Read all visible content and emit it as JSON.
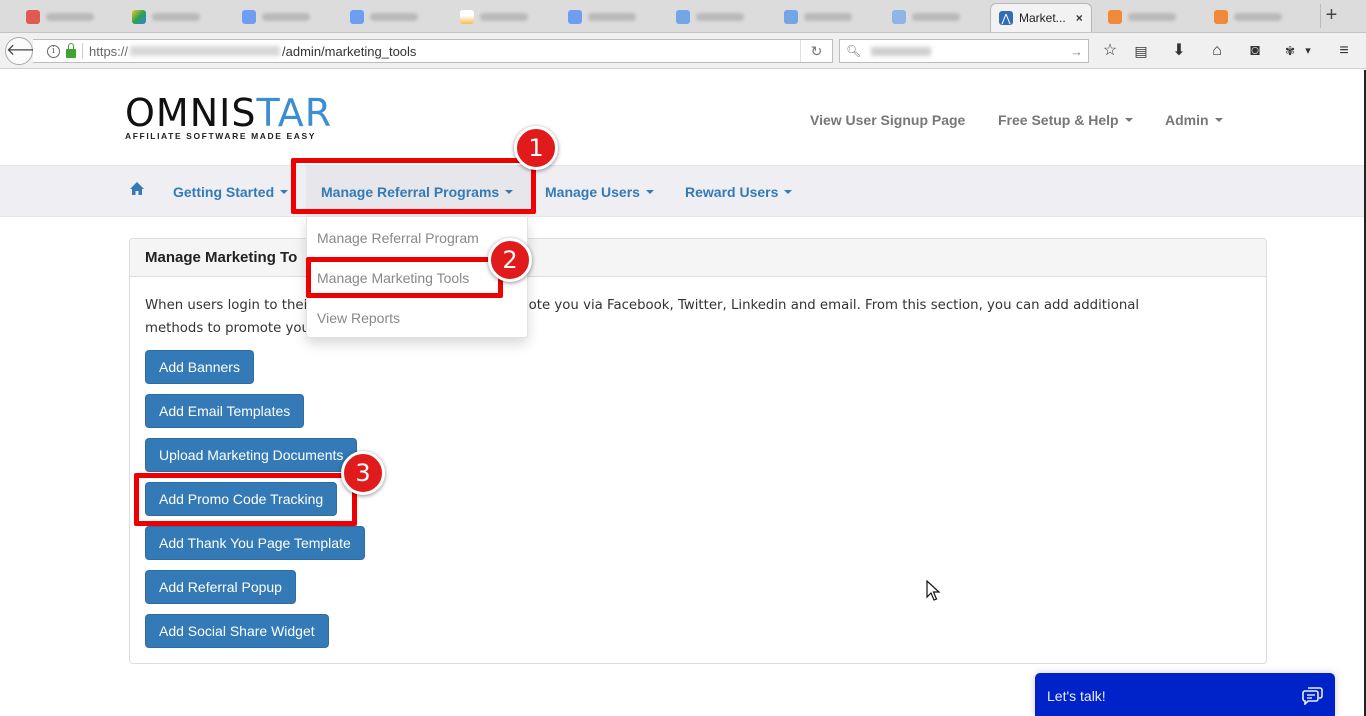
{
  "browser": {
    "tabs": [
      {
        "favicon": "gmail-icon",
        "color": "#e05a4f"
      },
      {
        "favicon": "drive-icon",
        "color": "#2ba24c"
      },
      {
        "favicon": "doc-icon",
        "color": "#6e9ef2"
      },
      {
        "favicon": "doc-icon",
        "color": "#6e9ef2"
      },
      {
        "favicon": "image-icon",
        "color": "#f2c14e"
      },
      {
        "favicon": "doc-icon",
        "color": "#6e9ef2"
      },
      {
        "favicon": "page-icon",
        "color": "#72a6e6"
      },
      {
        "favicon": "page-icon",
        "color": "#72a6e6"
      },
      {
        "favicon": "page-icon",
        "color": "#8fb5e8"
      }
    ],
    "active_tab": {
      "label": "Market...",
      "close": "×"
    },
    "tabs_after": [
      {
        "favicon": "orange-icon",
        "color": "#f08a3a"
      },
      {
        "favicon": "orange-icon",
        "color": "#f08a3a"
      }
    ],
    "new_tab": "+",
    "url_prefix": "https://",
    "url_path": "/admin/marketing_tools",
    "reload": "↻",
    "search_go": "→"
  },
  "site": {
    "logo_main_dark": "OMNIS",
    "logo_main_blue": "TAR",
    "logo_tagline": "AFFILIATE SOFTWARE MADE EASY",
    "top_links": {
      "signup": "View User Signup Page",
      "help": "Free Setup & Help",
      "admin": "Admin"
    },
    "nav": {
      "getting_started": "Getting Started",
      "manage_referral": "Manage Referral Programs",
      "manage_users": "Manage Users",
      "reward_users": "Reward Users"
    },
    "dropdown": [
      "Manage Referral Program",
      "Manage Marketing Tools",
      "View Reports"
    ],
    "panel": {
      "title": "Manage Marketing To",
      "desc_line1_a": "When users login to thei",
      "desc_line1_b": "le to promote you via Facebook, Twitter, Linkedin and email. From this section, you can add additional",
      "desc_line2": "methods to promote you"
    },
    "buttons": [
      "Add Banners",
      "Add Email Templates",
      "Upload Marketing Documents",
      "Add Promo Code Tracking",
      "Add Thank You Page Template",
      "Add Referral Popup",
      "Add Social Share Widget"
    ],
    "annotations": [
      "1",
      "2",
      "3"
    ],
    "chat": {
      "label": "Let's talk!"
    },
    "colors": {
      "primary": "#337ab7",
      "highlight": "#ee0000",
      "chat": "#0022c9"
    }
  }
}
